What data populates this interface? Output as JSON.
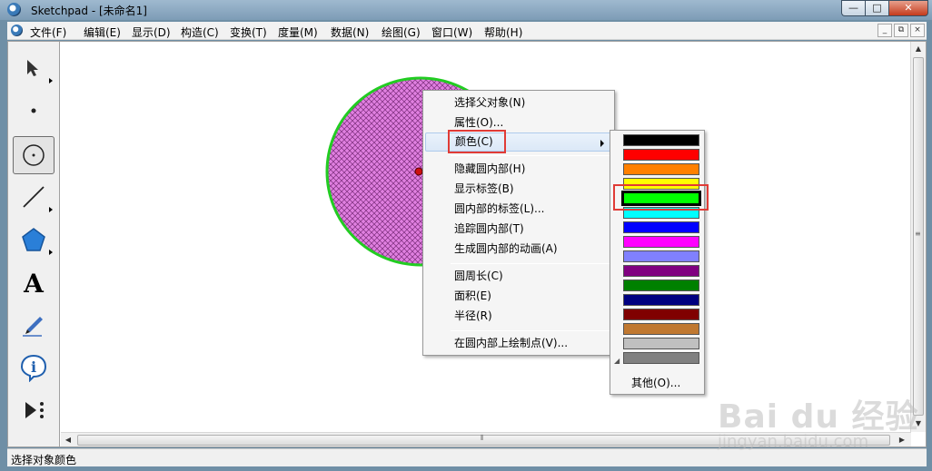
{
  "window": {
    "title": "Sketchpad  - [未命名1]",
    "controls": [
      "—",
      "□",
      "✕"
    ]
  },
  "menubar": {
    "items": [
      "文件(F)",
      "编辑(E)",
      "显示(D)",
      "构造(C)",
      "变换(T)",
      "度量(M)",
      "数据(N)",
      "绘图(G)",
      "窗口(W)",
      "帮助(H)"
    ],
    "mdi_controls": [
      "_",
      "⧉",
      "×"
    ]
  },
  "toolbox": {
    "tools": [
      "arrow-tool",
      "point-tool",
      "compass-tool",
      "straightedge-tool",
      "polygon-tool",
      "text-tool",
      "marker-tool",
      "information-tool",
      "custom-tool"
    ],
    "text_tool_glyph": "A",
    "selected": "compass-tool"
  },
  "canvas": {
    "circle_fill": "#e080e0",
    "circle_stroke": "#22cc22",
    "center_point_color": "#cc1111"
  },
  "context_menu": {
    "groups": [
      [
        "选择父对象(N)",
        "属性(O)...",
        "颜色(C)"
      ],
      [
        "隐藏圆内部(H)",
        "显示标签(B)",
        "圆内部的标签(L)...",
        "追踪圆内部(T)",
        "生成圆内部的动画(A)"
      ],
      [
        "圆周长(C)",
        "面积(E)",
        "半径(R)"
      ],
      [
        "在圆内部上绘制点(V)..."
      ]
    ],
    "highlighted": "颜色(C)"
  },
  "color_menu": {
    "swatches": [
      "#000000",
      "#ff0000",
      "#ff8000",
      "#ffff00",
      "#00ff00",
      "#00ffff",
      "#0000ff",
      "#ff00ff",
      "#8080ff",
      "#800080",
      "#008000",
      "#000080",
      "#800000",
      "#c07830",
      "#c0c0c0",
      "#808080"
    ],
    "selected_index": 4,
    "other_label": "其他(O)..."
  },
  "statusbar": {
    "text": "选择对象颜色"
  },
  "watermark": {
    "logo": "Bai du 经验",
    "url": "jingyan.baidu.com"
  }
}
